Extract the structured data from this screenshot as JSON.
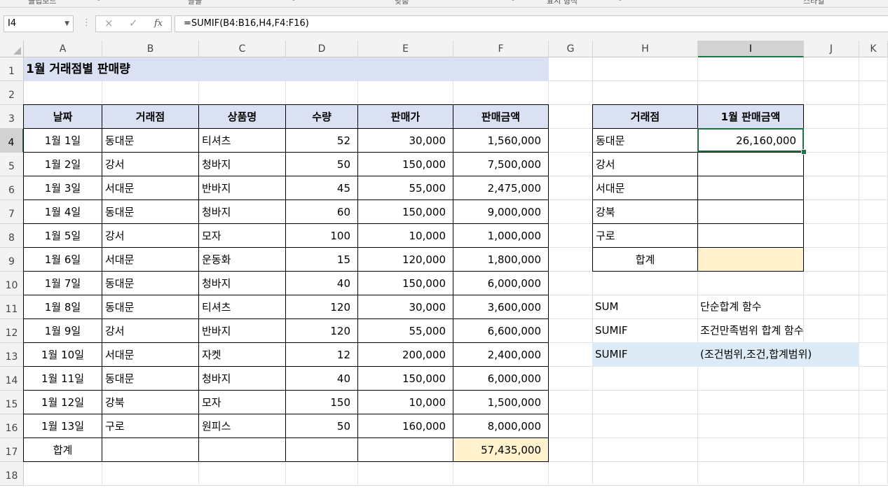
{
  "ribbon": {
    "groups": [
      "클립보드",
      "글꼴",
      "맞춤",
      "표시 형식",
      "스타일"
    ]
  },
  "formula_bar": {
    "name_box": "I4",
    "cancel_icon": "×",
    "enter_icon": "✓",
    "fx_icon": "fx",
    "formula": "=SUMIF(B4:B16,H4,F4:F16)"
  },
  "columns": [
    "A",
    "B",
    "C",
    "D",
    "E",
    "F",
    "G",
    "H",
    "I",
    "J",
    "K"
  ],
  "rows": [
    "1",
    "2",
    "3",
    "4",
    "5",
    "6",
    "7",
    "8",
    "9",
    "10",
    "11",
    "12",
    "13",
    "14",
    "15",
    "16",
    "17",
    "18"
  ],
  "selected_cell": {
    "column": "I",
    "row": "4"
  },
  "sheet": {
    "title": "1월 거래점별 판매량",
    "headers": [
      "날짜",
      "거래점",
      "상품명",
      "수량",
      "판매가",
      "판매금액"
    ],
    "records": [
      [
        "1월 1일",
        "동대문",
        "티셔츠",
        "52",
        "30,000",
        "1,560,000"
      ],
      [
        "1월 2일",
        "강서",
        "청바지",
        "50",
        "150,000",
        "7,500,000"
      ],
      [
        "1월 3일",
        "서대문",
        "반바지",
        "45",
        "55,000",
        "2,475,000"
      ],
      [
        "1월 4일",
        "동대문",
        "청바지",
        "60",
        "150,000",
        "9,000,000"
      ],
      [
        "1월 5일",
        "강서",
        "모자",
        "100",
        "10,000",
        "1,000,000"
      ],
      [
        "1월 6일",
        "서대문",
        "운동화",
        "15",
        "120,000",
        "1,800,000"
      ],
      [
        "1월 7일",
        "동대문",
        "청바지",
        "40",
        "150,000",
        "6,000,000"
      ],
      [
        "1월 8일",
        "동대문",
        "티셔츠",
        "120",
        "30,000",
        "3,600,000"
      ],
      [
        "1월 9일",
        "강서",
        "반바지",
        "120",
        "55,000",
        "6,600,000"
      ],
      [
        "1월 10일",
        "서대문",
        "자켓",
        "12",
        "200,000",
        "2,400,000"
      ],
      [
        "1월 11일",
        "동대문",
        "청바지",
        "40",
        "150,000",
        "6,000,000"
      ],
      [
        "1월 12일",
        "강북",
        "모자",
        "150",
        "10,000",
        "1,500,000"
      ],
      [
        "1월 13일",
        "구로",
        "원피스",
        "50",
        "160,000",
        "8,000,000"
      ]
    ],
    "total_label": "합계",
    "total_amount": "57,435,000",
    "summary_headers": [
      "거래점",
      "1월 판매금액"
    ],
    "summary_rows": [
      [
        "동대문",
        "26,160,000"
      ],
      [
        "강서",
        ""
      ],
      [
        "서대문",
        ""
      ],
      [
        "강북",
        ""
      ],
      [
        "구로",
        ""
      ]
    ],
    "summary_total_label": "합계",
    "summary_total_value": "",
    "notes": [
      [
        "SUM",
        "단순합계 함수"
      ],
      [
        "SUMIF",
        "조건만족범위 합계 함수"
      ],
      [
        "SUMIF",
        "(조건범위,조건,합계범위)"
      ]
    ]
  },
  "colors": {
    "header_fill": "#d9e1f2",
    "total_fill": "#fff2cc",
    "note_fill": "#ddebf7",
    "selection": "#217346"
  }
}
